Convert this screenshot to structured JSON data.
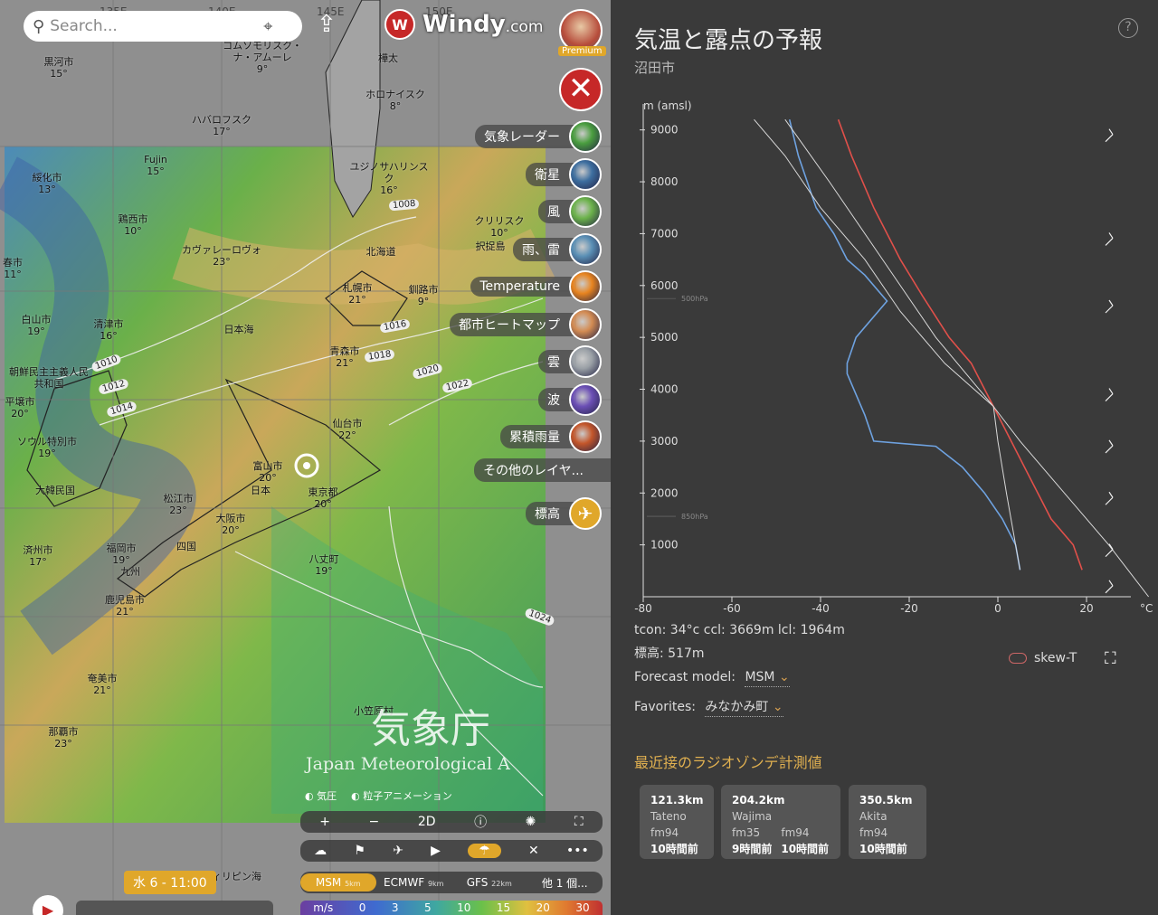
{
  "search": {
    "placeholder": "Search..."
  },
  "brand": {
    "name": "Windy",
    "suffix": ".com",
    "premium": "Premium"
  },
  "places": [
    {
      "n": "ユジノサハリンスク",
      "t": "16°"
    },
    {
      "n": "ハバロフスク",
      "t": "17°"
    },
    {
      "n": "ホロナイスク",
      "t": "8°"
    },
    {
      "n": "黒河市",
      "t": "15°"
    },
    {
      "n": "Fujin",
      "t": "15°"
    },
    {
      "n": "綏化市",
      "t": "13°"
    },
    {
      "n": "鶏西市",
      "t": "10°"
    },
    {
      "n": "カヴァレーロヴォ",
      "t": "23°"
    },
    {
      "n": "春市",
      "t": "11°"
    },
    {
      "n": "白山市",
      "t": "19°"
    },
    {
      "n": "清津市",
      "t": "16°"
    },
    {
      "n": "平壌市",
      "t": "20°"
    },
    {
      "n": "ソウル特別市",
      "t": "19°"
    },
    {
      "n": "済州市",
      "t": "17°"
    },
    {
      "n": "福岡市",
      "t": "19°"
    },
    {
      "n": "鹿児島市",
      "t": "21°"
    },
    {
      "n": "奄美市",
      "t": "21°"
    },
    {
      "n": "那覇市",
      "t": "23°"
    },
    {
      "n": "松江市",
      "t": "23°"
    },
    {
      "n": "大阪市",
      "t": "20°"
    },
    {
      "n": "富山市",
      "t": "20°"
    },
    {
      "n": "東京都",
      "t": "20°"
    },
    {
      "n": "八丈町",
      "t": "19°"
    },
    {
      "n": "仙台市",
      "t": "22°"
    },
    {
      "n": "青森市",
      "t": "21°"
    },
    {
      "n": "札幌市",
      "t": "21°"
    },
    {
      "n": "釧路市",
      "t": "9°"
    },
    {
      "n": "クリリスク",
      "t": "10°"
    },
    {
      "n": "択捉島",
      "t": ""
    },
    {
      "n": "北海道",
      "t": ""
    },
    {
      "n": "日本海",
      "t": ""
    },
    {
      "n": "四国",
      "t": ""
    },
    {
      "n": "九州",
      "t": ""
    },
    {
      "n": "日本",
      "t": ""
    },
    {
      "n": "樺太",
      "t": ""
    },
    {
      "n": "大韓民国",
      "t": ""
    },
    {
      "n": "朝鮮民主主義人民共和国",
      "t": ""
    },
    {
      "n": "コムソモリスク・ナ・アムーレ",
      "t": "9°"
    },
    {
      "n": "小笠原村",
      "t": ""
    },
    {
      "n": "フィリピン海",
      "t": ""
    }
  ],
  "isobars": [
    "1008",
    "1016",
    "1018",
    "1020",
    "1022",
    "1010",
    "1012",
    "1014",
    "1024"
  ],
  "coords": [
    "135E",
    "140E",
    "145E",
    "150E"
  ],
  "layers": [
    {
      "label": "気象レーダー",
      "color": "#4a9e3f"
    },
    {
      "label": "衛星",
      "color": "#3d6e9f"
    },
    {
      "label": "風",
      "color": "#6bb24a"
    },
    {
      "label": "雨、雷",
      "color": "#5a8fb5"
    },
    {
      "label": "Temperature",
      "color": "#e8841f"
    },
    {
      "label": "都市ヒートマップ",
      "color": "#d38b52"
    },
    {
      "label": "雲",
      "color": "#9aa0a6"
    },
    {
      "label": "波",
      "color": "#6b4fb5"
    },
    {
      "label": "累積雨量",
      "color": "#c4562a"
    }
  ],
  "more_layers": "その他のレイヤ...",
  "elevation": "標高",
  "watermark": {
    "jp": "気象庁",
    "en": "Japan Meteorological A"
  },
  "toggles": {
    "pressure": "気圧",
    "particles": "粒子アニメーション"
  },
  "controls": {
    "plus": "+",
    "minus": "−",
    "mode": "2D"
  },
  "models_bar": [
    {
      "name": "MSM",
      "res": "5km"
    },
    {
      "name": "ECMWF",
      "res": "9km"
    },
    {
      "name": "GFS",
      "res": "22km"
    },
    {
      "name": "他 1 個...",
      "res": ""
    }
  ],
  "scale": {
    "unit": "m/s",
    "ticks": [
      "0",
      "3",
      "5",
      "10",
      "15",
      "20",
      "30"
    ]
  },
  "time": {
    "label": "水 6 - 11:00"
  },
  "panel": {
    "title": "気温と露点の予報",
    "location": "沼田市",
    "y_axis_label": "m (amsl)",
    "x_unit": "°C",
    "pressure_labels": [
      "500hPa",
      "850hPa"
    ],
    "stats": "tcon: 34°c ccl: 3669m lcl: 1964m",
    "elevation": "標高: 517m",
    "forecast_model_label": "Forecast model:",
    "forecast_model": "MSM",
    "favorites_label": "Favorites:",
    "favorites": "みなかみ町",
    "skewt": "skew-T",
    "radiosonde_title": "最近接のラジオゾンデ計測値",
    "cards": [
      {
        "dist": "121.3km",
        "station": "Tateno",
        "runs": [
          {
            "m": "fm94",
            "t": "10時間前"
          }
        ]
      },
      {
        "dist": "204.2km",
        "station": "Wajima",
        "runs": [
          {
            "m": "fm35",
            "t": "9時間前"
          },
          {
            "m": "fm94",
            "t": "10時間前"
          }
        ]
      },
      {
        "dist": "350.5km",
        "station": "Akita",
        "runs": [
          {
            "m": "fm94",
            "t": "10時間前"
          }
        ]
      }
    ]
  },
  "chart_data": {
    "type": "line",
    "title": "気温と露点の予報",
    "ylabel": "m (amsl)",
    "xlabel": "°C",
    "xlim": [
      -80,
      30
    ],
    "ylim": [
      0,
      9500
    ],
    "x_ticks": [
      -80,
      -60,
      -40,
      -20,
      0,
      20
    ],
    "y_ticks": [
      1000,
      2000,
      3000,
      4000,
      5000,
      6000,
      7000,
      8000,
      9000
    ],
    "series": [
      {
        "name": "",
        "color": "#e0504a",
        "points": [
          [
            19,
            517
          ],
          [
            17,
            1000
          ],
          [
            12,
            1500
          ],
          [
            9,
            2000
          ],
          [
            6,
            2500
          ],
          [
            3,
            3000
          ],
          [
            -1,
            3669
          ],
          [
            -6,
            4500
          ],
          [
            -11,
            5000
          ],
          [
            -17,
            5800
          ],
          [
            -22,
            6500
          ],
          [
            -28,
            7500
          ],
          [
            -33,
            8500
          ],
          [
            -36,
            9200
          ]
        ]
      },
      {
        "name": "",
        "color": "#6ea2e0",
        "points": [
          [
            5,
            517
          ],
          [
            4,
            1000
          ],
          [
            1,
            1500
          ],
          [
            -3,
            2000
          ],
          [
            -8,
            2500
          ],
          [
            -14,
            2900
          ],
          [
            -28,
            3000
          ],
          [
            -30,
            3500
          ],
          [
            -34,
            4300
          ],
          [
            -34,
            4500
          ],
          [
            -32,
            5000
          ],
          [
            -25,
            5700
          ],
          [
            -30,
            6200
          ],
          [
            -34,
            6500
          ],
          [
            -37,
            7000
          ],
          [
            -41,
            7500
          ],
          [
            -43,
            8000
          ],
          [
            -45,
            8500
          ],
          [
            -47,
            9200
          ]
        ]
      },
      {
        "name": "",
        "color": "#d8d8d8",
        "points": [
          [
            5,
            517
          ],
          [
            4,
            1000
          ],
          [
            2,
            1964
          ],
          [
            0,
            3000
          ],
          [
            -1,
            3669
          ],
          [
            -12,
            4500
          ],
          [
            -22,
            5500
          ],
          [
            -30,
            6500
          ],
          [
            -40,
            7500
          ],
          [
            -48,
            8500
          ],
          [
            -55,
            9200
          ]
        ]
      },
      {
        "name": "",
        "color": "#d8d8d8",
        "points": [
          [
            34,
            0
          ],
          [
            25,
            1000
          ],
          [
            15,
            2000
          ],
          [
            5,
            3000
          ],
          [
            -1,
            3669
          ],
          [
            -14,
            5000
          ],
          [
            -26,
            6500
          ],
          [
            -38,
            8000
          ],
          [
            -48,
            9200
          ]
        ]
      }
    ]
  }
}
